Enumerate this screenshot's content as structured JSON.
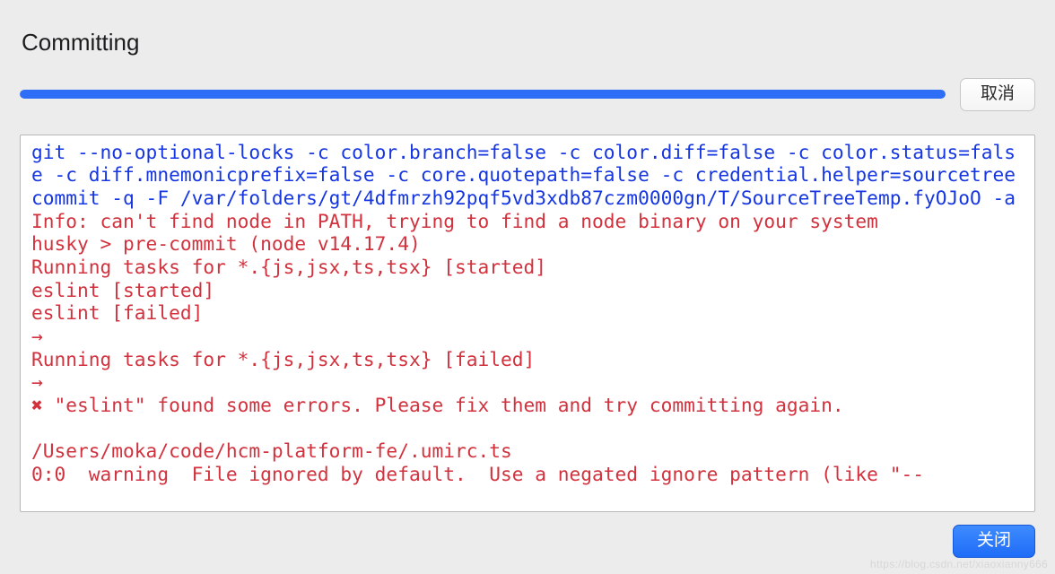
{
  "title": "Committing",
  "buttons": {
    "cancel": "取消",
    "close": "关闭"
  },
  "console": {
    "command": "git --no-optional-locks -c color.branch=false -c color.diff=false -c color.status=false -c diff.mnemonicprefix=false -c core.quotepath=false -c credential.helper=sourcetree commit -q -F /var/folders/gt/4dfmrzh92pqf5vd3xdb87czm0000gn/T/SourceTreeTemp.fyOJoO -a",
    "error": "Info: can't find node in PATH, trying to find a node binary on your system\nhusky > pre-commit (node v14.17.4)\nRunning tasks for *.{js,jsx,ts,tsx} [started]\neslint [started]\neslint [failed]\n→\nRunning tasks for *.{js,jsx,ts,tsx} [failed]\n→\n✖ \"eslint\" found some errors. Please fix them and try committing again.\n\n/Users/moka/code/hcm-platform-fe/.umirc.ts\n0:0  warning  File ignored by default.  Use a negated ignore pattern (like \"--"
  },
  "watermark": "https://blog.csdn.net/xiaoxianny666"
}
